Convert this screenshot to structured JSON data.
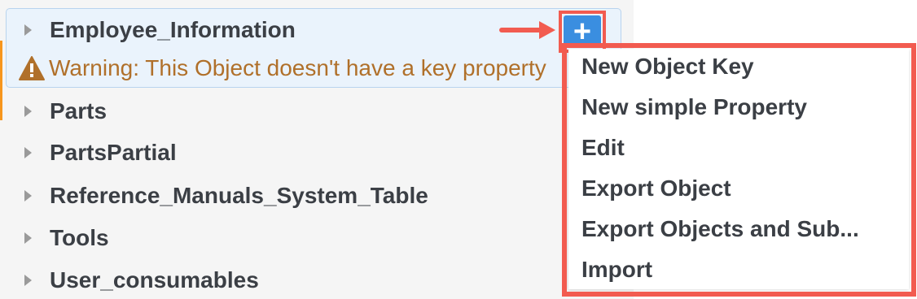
{
  "tree": {
    "items": [
      {
        "label": "Employee_Information"
      },
      {
        "label": "Parts"
      },
      {
        "label": "PartsPartial"
      },
      {
        "label": "Reference_Manuals_System_Table"
      },
      {
        "label": "Tools"
      },
      {
        "label": "User_consumables"
      }
    ],
    "warning": {
      "text": "Warning: This Object doesn't have a key property",
      "icon": "warning-triangle-icon"
    }
  },
  "add_button": {
    "glyph": "+",
    "icon": "plus-icon"
  },
  "context_menu": {
    "items": [
      {
        "label": "New Object Key"
      },
      {
        "label": "New simple Property"
      },
      {
        "label": "Edit"
      },
      {
        "label": "Export Object"
      },
      {
        "label": "Export Objects and Sub..."
      },
      {
        "label": "Import"
      }
    ]
  },
  "colors": {
    "highlight": "#f25b50",
    "accent": "#f7961d",
    "button": "#3a8ee0",
    "warning": "#b0702a"
  }
}
